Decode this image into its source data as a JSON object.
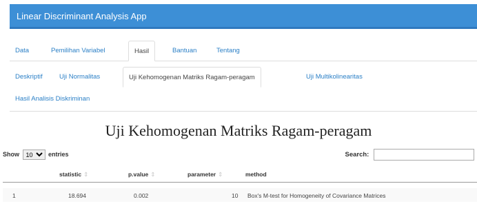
{
  "app_title": "Linear Discriminant Analysis App",
  "main_tabs": [
    {
      "label": "Data"
    },
    {
      "label": "Pemilihan Variabel"
    },
    {
      "label": "Hasil"
    },
    {
      "label": "Bantuan"
    },
    {
      "label": "Tentang"
    }
  ],
  "sub_tabs": [
    {
      "label": "Deskriptif"
    },
    {
      "label": "Uji Normalitas"
    },
    {
      "label": "Uji Kehomogenan Matriks Ragam-peragam"
    },
    {
      "label": "Uji Multikolinearitas"
    },
    {
      "label": "Hasil Analisis Diskriminan"
    }
  ],
  "section_title": "Uji Kehomogenan Matriks Ragam-peragam",
  "table_controls": {
    "show_label": "Show",
    "entries_value": "10",
    "entries_label": "entries",
    "search_label": "Search:",
    "search_value": ""
  },
  "table": {
    "columns": [
      "statistic",
      "p.value",
      "parameter",
      "method"
    ],
    "rows": [
      {
        "index": "1",
        "statistic": "18.694",
        "p_value": "0.002",
        "parameter": "10",
        "method": "Box's M-test for Homogeneity of Covariance Matrices"
      }
    ]
  },
  "colors": {
    "navbar": "#3d8fd6",
    "link": "#2a7fc6"
  }
}
